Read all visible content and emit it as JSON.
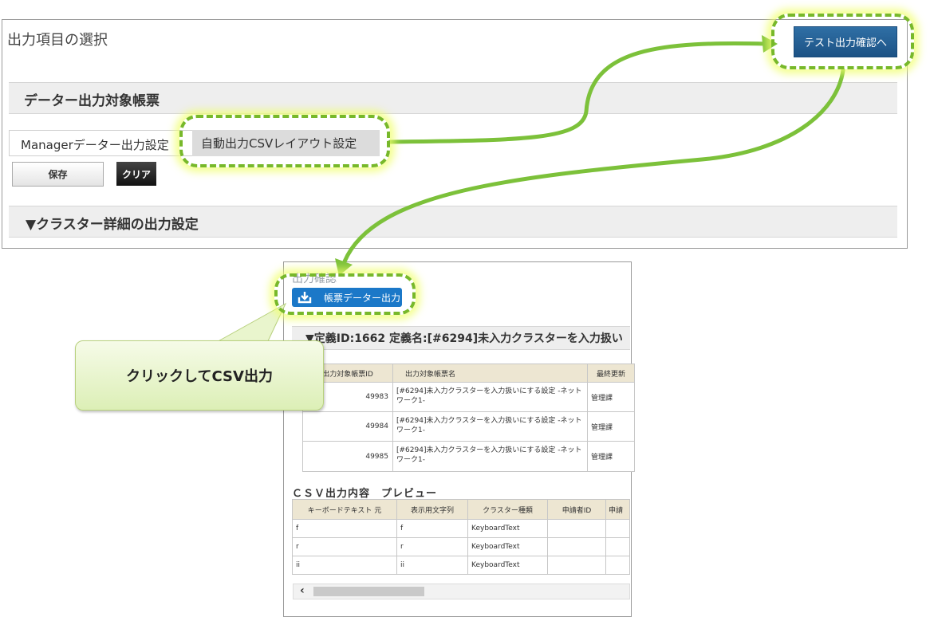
{
  "top": {
    "title": "出力項目の選択",
    "test_button": "テスト出力確認へ",
    "section1_label": "データー出力対象帳票",
    "tab_manager": "Managerデーター出力設定",
    "tab_auto_csv": "自動出力CSVレイアウト設定",
    "save_button": "保存",
    "clear_button": "クリア",
    "section2_label": "▼クラスター詳細の出力設定"
  },
  "output": {
    "title": "出力確認",
    "export_button": "帳票データー出力",
    "export_icon": "download-icon",
    "definition_label": "▼定義ID:1662 定義名:[#6294]未入力クラスターを入力扱い",
    "report_table": {
      "headers": [
        "出力対象帳票ID",
        "出力対象帳票名",
        "最終更新"
      ],
      "rows": [
        {
          "id": "49983",
          "name": "[#6294]未入力クラスターを入力扱いにする設定 -ネットワーク1-",
          "dept": "管理課"
        },
        {
          "id": "49984",
          "name": "[#6294]未入力クラスターを入力扱いにする設定 -ネットワーク1-",
          "dept": "管理課"
        },
        {
          "id": "49985",
          "name": "[#6294]未入力クラスターを入力扱いにする設定 -ネットワーク1-",
          "dept": "管理課"
        }
      ]
    },
    "preview_title": "ＣＳＶ出力内容　プレビュー",
    "preview_table": {
      "headers": [
        "キーボードテキスト 元",
        "表示用文字列",
        "クラスター種類",
        "申請者ID",
        "申請"
      ],
      "rows": [
        [
          "f",
          "f",
          "KeyboardText",
          "",
          ""
        ],
        [
          "r",
          "r",
          "KeyboardText",
          "",
          ""
        ],
        [
          "ii",
          "ii",
          "KeyboardText",
          "",
          ""
        ]
      ]
    },
    "scroll_left_glyph": "‹"
  },
  "callout_text": "クリックしてCSV出力",
  "colors": {
    "highlight_dash": "#77b82a",
    "highlight_glow": "#f0ff6e",
    "arrow": "#7cc13a",
    "primary_button": "#1c5285",
    "export_button": "#1b78c8",
    "callout_fill": "#dcefb6",
    "header_fill": "#ede6d2"
  }
}
